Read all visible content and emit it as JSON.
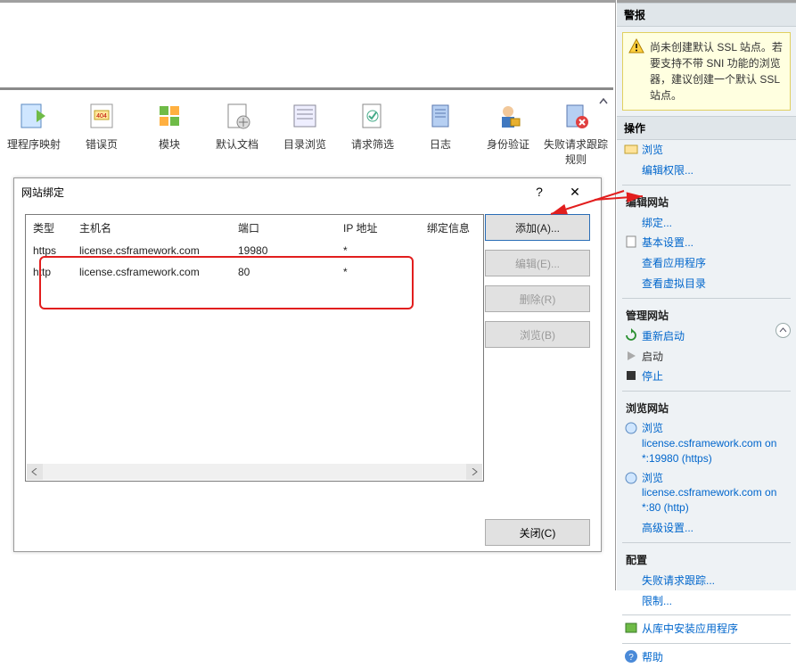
{
  "toolbar": [
    {
      "label": "理程序映射"
    },
    {
      "label": "错误页"
    },
    {
      "label": "模块"
    },
    {
      "label": "默认文档"
    },
    {
      "label": "目录浏览"
    },
    {
      "label": "请求筛选"
    },
    {
      "label": "日志"
    },
    {
      "label": "身份验证"
    },
    {
      "label": "失败请求跟踪规则"
    }
  ],
  "dialog": {
    "title": "网站绑定",
    "help": "?",
    "close_x": "✕",
    "columns": {
      "type": "类型",
      "host": "主机名",
      "port": "端口",
      "ip": "IP 地址",
      "bind": "绑定信息"
    },
    "rows": [
      {
        "type": "https",
        "host": "license.csframework.com",
        "port": "19980",
        "ip": "*",
        "bind": ""
      },
      {
        "type": "http",
        "host": "license.csframework.com",
        "port": "80",
        "ip": "*",
        "bind": ""
      }
    ],
    "buttons": {
      "add": "添加(A)...",
      "edit": "编辑(E)...",
      "remove": "删除(R)",
      "browse": "浏览(B)"
    },
    "close": "关闭(C)"
  },
  "right": {
    "alerts_title": "警报",
    "alert_text": "尚未创建默认 SSL 站点。若要支持不带 SNI 功能的浏览器，建议创建一个默认 SSL 站点。",
    "actions_title": "操作",
    "browse": "浏览",
    "edit_permissions": "编辑权限...",
    "edit_site": "编辑网站",
    "bindings": "绑定...",
    "basic_settings": "基本设置...",
    "view_apps": "查看应用程序",
    "view_vdirs": "查看虚拟目录",
    "manage_site": "管理网站",
    "restart": "重新启动",
    "start": "启动",
    "stop": "停止",
    "browse_site": "浏览网站",
    "browse1_top": "浏览",
    "browse1": "license.csframework.com on *:19980 (https)",
    "browse2_top": "浏览",
    "browse2": "license.csframework.com on *:80 (http)",
    "advanced": "高级设置...",
    "configure": "配置",
    "failed_trace": "失败请求跟踪...",
    "limits": "限制...",
    "install_from_gallery": "从库中安装应用程序",
    "help": "帮助"
  }
}
